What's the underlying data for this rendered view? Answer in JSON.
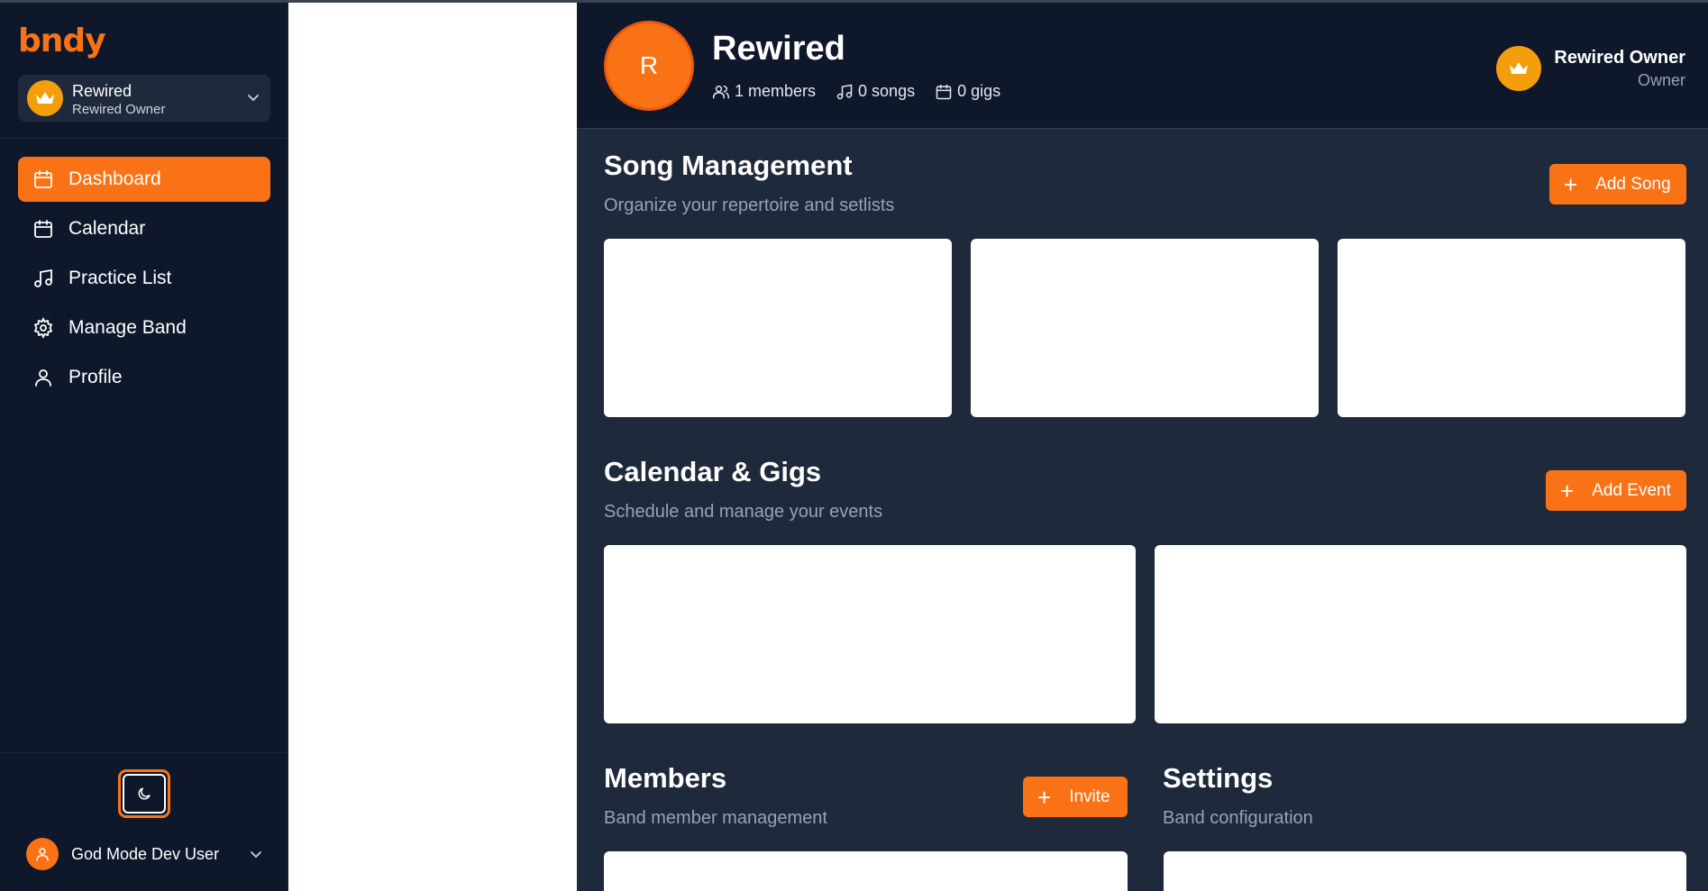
{
  "app": {
    "logo_text": "bndy",
    "accent_color": "#f97316",
    "sidebar_bg": "#0f172a"
  },
  "band_switcher": {
    "name": "Rewired",
    "role": "Rewired Owner",
    "icon": "crown-icon"
  },
  "nav": {
    "items": [
      {
        "label": "Dashboard",
        "icon": "calendar-icon",
        "active": true
      },
      {
        "label": "Calendar",
        "icon": "calendar-icon",
        "active": false
      },
      {
        "label": "Practice List",
        "icon": "music-note-icon",
        "active": false
      },
      {
        "label": "Manage Band",
        "icon": "gear-icon",
        "active": false
      },
      {
        "label": "Profile",
        "icon": "user-icon",
        "active": false
      }
    ]
  },
  "footer": {
    "theme_icon": "moon-icon",
    "user_name": "God Mode Dev User"
  },
  "header": {
    "avatar_letter": "R",
    "band_name": "Rewired",
    "members": "1 members",
    "songs": "0 songs",
    "gigs": "0 gigs",
    "owner_name": "Rewired Owner",
    "owner_role": "Owner"
  },
  "songs": {
    "title": "Song Management",
    "subtitle": "Organize your repertoire and setlists",
    "button": "Add Song"
  },
  "calendar": {
    "title": "Calendar & Gigs",
    "subtitle": "Schedule and manage your events",
    "button": "Add Event"
  },
  "members": {
    "title": "Members",
    "subtitle": "Band member management",
    "button": "Invite"
  },
  "settings": {
    "title": "Settings",
    "subtitle": "Band configuration"
  }
}
